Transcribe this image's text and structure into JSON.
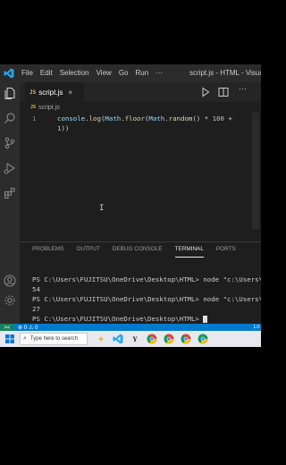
{
  "titlebar": {
    "menu": [
      "File",
      "Edit",
      "Selection",
      "View",
      "Go",
      "Run",
      "···"
    ],
    "window_title": "script.js - HTML - Visual"
  },
  "tabs": [
    {
      "badge": "JS",
      "label": "script.js",
      "close": "×",
      "active": true
    }
  ],
  "more_actions": "···",
  "breadcrumb": {
    "badge": "JS",
    "file": "script.js"
  },
  "editor": {
    "line_number": "1",
    "code": {
      "obj1": "console",
      "dot1": ".",
      "fn1": "log",
      "p1": "(",
      "obj2": "Math",
      "dot2": ".",
      "fn2": "floor",
      "p2": "(",
      "obj3": "Math",
      "dot3": ".",
      "fn3": "random",
      "p3": "() * ",
      "num1": "100",
      "op": " +",
      "indent": "",
      "num2": "1",
      "close": "))"
    },
    "text_cursor": "I"
  },
  "panel": {
    "tabs": [
      "PROBLEMS",
      "OUTPUT",
      "DEBUG CONSOLE",
      "TERMINAL",
      "PORTS"
    ],
    "active_tab": "TERMINAL"
  },
  "terminal": {
    "lines": [
      "PS C:\\Users\\FUJITSU\\OneDrive\\Desktop\\HTML> node \"c:\\Users\\",
      "54",
      "PS C:\\Users\\FUJITSU\\OneDrive\\Desktop\\HTML> node \"c:\\Users\\",
      "27",
      "PS C:\\Users\\FUJITSU\\OneDrive\\Desktop\\HTML> "
    ]
  },
  "statusbar": {
    "remote": "><",
    "problems": "⊗ 0",
    "warnings": "⚠ 0",
    "lang": "Ln"
  },
  "taskbar": {
    "search_placeholder": "Type here to search",
    "icons": [
      "sparkle",
      "vscode",
      "yandex",
      "chrome",
      "chrome-profile",
      "chrome",
      "chrome-alt"
    ]
  },
  "colors": {
    "accent": "#007acc",
    "editor_bg": "#1e1e1e",
    "js_badge": "#e8c33a"
  }
}
